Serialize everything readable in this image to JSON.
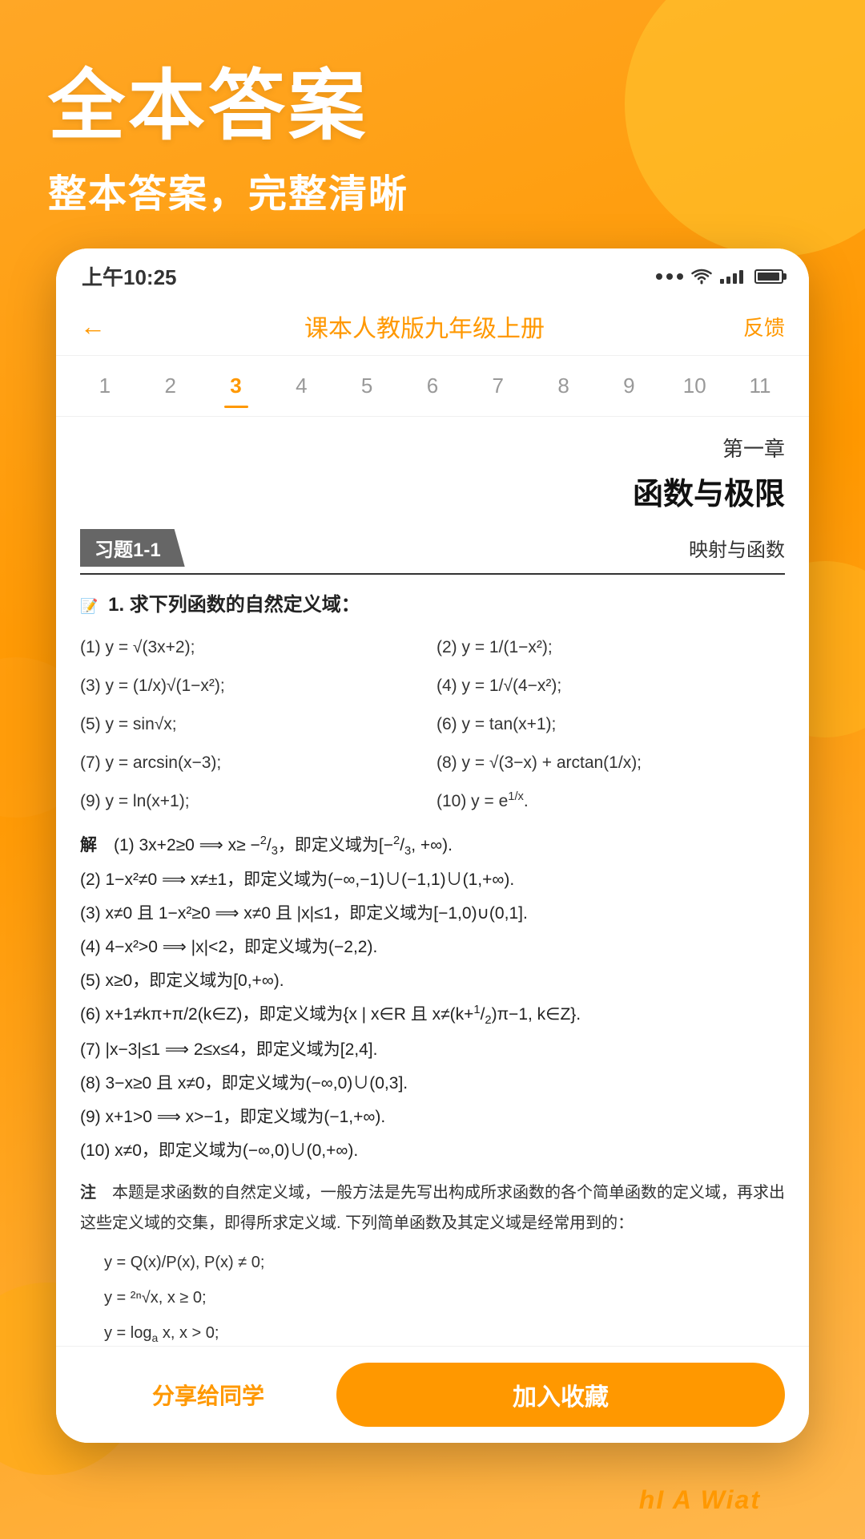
{
  "background": {
    "color": "#FF9800"
  },
  "hero": {
    "title": "全本答案",
    "subtitle": "整本答案，完整清晰"
  },
  "statusBar": {
    "time": "上午10:25",
    "dots": "···",
    "wifi": "wifi",
    "signal": "signal",
    "battery": "battery"
  },
  "appHeader": {
    "back": "←",
    "title": "课本人教版九年级上册",
    "feedback": "反馈"
  },
  "tabs": {
    "items": [
      "1",
      "2",
      "3",
      "4",
      "5",
      "6",
      "7",
      "8",
      "9",
      "10",
      "11"
    ],
    "activeIndex": 2
  },
  "chapter": {
    "number": "第一章",
    "title": "函数与极限"
  },
  "exercise": {
    "tag": "习题1-1",
    "topic": "映射与函数"
  },
  "problem": {
    "title": "1. 求下列函数的自然定义域：",
    "items": [
      {
        "num": "(1)",
        "expr": "y = √(3x+2);"
      },
      {
        "num": "(2)",
        "expr": "y = 1/(1-x²);"
      },
      {
        "num": "(3)",
        "expr": "y = (1/x)√(1-x²);"
      },
      {
        "num": "(4)",
        "expr": "y = 1/√(4-x²);"
      },
      {
        "num": "(5)",
        "expr": "y = sin√x;"
      },
      {
        "num": "(6)",
        "expr": "y = tan(x+1);"
      },
      {
        "num": "(7)",
        "expr": "y = arcsin(x-3);"
      },
      {
        "num": "(8)",
        "expr": "y = √(3-x) + arctan(1/x);"
      },
      {
        "num": "(9)",
        "expr": "y = ln(x+1);"
      },
      {
        "num": "(10)",
        "expr": "y = e^(1/x)."
      }
    ]
  },
  "solution": {
    "title": "解",
    "lines": [
      "(1) 3x+2≥0⟹x≥ -2/3，即定义域为[-2/3, +∞).",
      "(2) 1-x²≠0 ⟹x≠±1,即定义域为(-∞,-1)∪(-1,1)∪(1,+∞).",
      "(3) x≠0 且 1-x²≥0 ⟹x≠0 且|x|≤1,即定义域为[-1,0)∪(0,1].",
      "(4) 4-x²>0 ⟹|x|<2,即定义域为(-2,2).",
      "(5) x≥0,即定义域为[0,+∞).",
      "(6) x+1≠kπ+π/2(k∈Z),即定义域为{x|x∈R 且 x≠(k+1/2)π-1,k∈Z}.",
      "(7) |x-3|≤1⟹2≤x≤4,即定义域为[2,4].",
      "(8) 3-x≥0 且 x≠0,即定义域为(-∞,0)∪(0,3].",
      "(9) x+1>0 ⟹x>-1,即定义域为(-1,+∞).",
      "(10) x≠0,即定义域为(-∞,0)∪(0,+∞)."
    ]
  },
  "note": {
    "title": "注",
    "content": "本题是求函数的自然定义域，一般方法是先写出构成所求函数的各个简单函数的定义域，再求出这些定义域的交集，即得所求定义域. 下列简单函数及其定义域是经常用到的：",
    "formulas": [
      "y = Q(x)/P(x), P(x) ≠ 0;",
      "y = ²ⁿ√x, x ≥ 0;",
      "y = log_a x, x > 0;"
    ]
  },
  "actionBar": {
    "share": "分享给同学",
    "collect": "加入收藏"
  },
  "bottomText": "hI A Wiat"
}
